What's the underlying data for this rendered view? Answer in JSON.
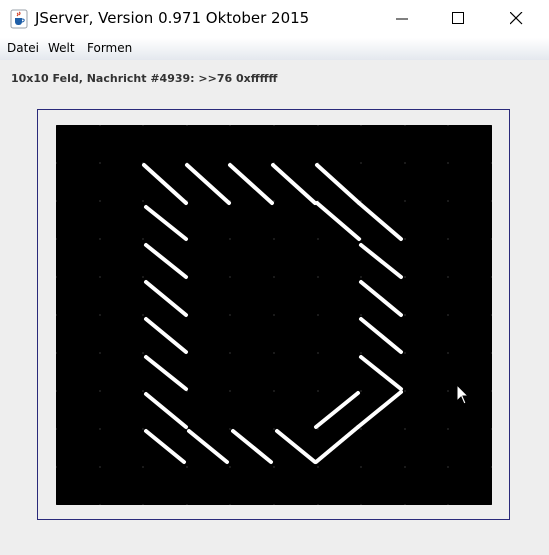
{
  "window": {
    "title": "JServer, Version 0.971 Oktober 2015",
    "icon": "java-cup-icon",
    "controls": [
      "minimize-icon",
      "maximize-icon",
      "close-icon"
    ]
  },
  "menu": {
    "items": [
      {
        "label": "Datei"
      },
      {
        "label": "Welt"
      },
      {
        "label": "Formen"
      }
    ]
  },
  "status": {
    "text": "10x10 Feld, Nachricht #4939: >>76 0xffffff"
  },
  "board": {
    "columns": 10,
    "rows": 10,
    "background_color": "#000000",
    "foreground_color": "#ffffff",
    "shape": "letter D drawn with diagonal white strokes"
  },
  "colors": {
    "titlebar_bg": "#ffffff",
    "window_bg": "#eeeeee",
    "frame_border": "#2a2a7a"
  }
}
